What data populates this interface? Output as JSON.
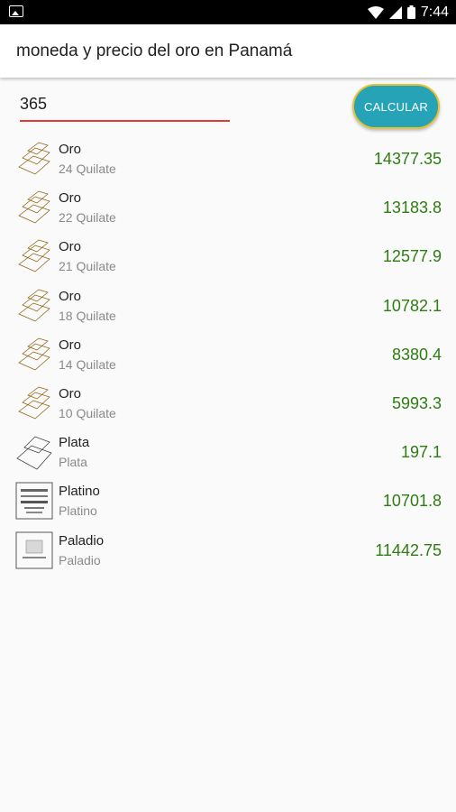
{
  "status_bar": {
    "time": "7:44"
  },
  "app": {
    "title": "moneda y precio del oro en Panamá"
  },
  "input": {
    "value": "365"
  },
  "calculate_button": {
    "label": "CALCULAR"
  },
  "colors": {
    "accent": "#26a3b6",
    "price": "#2e7d12",
    "underline": "#e53935"
  },
  "items": [
    {
      "name": "Oro",
      "subtitle": "24 Quilate",
      "price": "14377.35",
      "icon": "gold-bars-icon"
    },
    {
      "name": "Oro",
      "subtitle": "22 Quilate",
      "price": "13183.8",
      "icon": "gold-bars-icon"
    },
    {
      "name": "Oro",
      "subtitle": "21 Quilate",
      "price": "12577.9",
      "icon": "gold-bars-icon"
    },
    {
      "name": "Oro",
      "subtitle": "18 Quilate",
      "price": "10782.1",
      "icon": "gold-bars-icon"
    },
    {
      "name": "Oro",
      "subtitle": "14 Quilate",
      "price": "8380.4",
      "icon": "gold-bars-icon"
    },
    {
      "name": "Oro",
      "subtitle": "10 Quilate",
      "price": "5993.3",
      "icon": "gold-bars-icon"
    },
    {
      "name": "Plata",
      "subtitle": "Plata",
      "price": "197.1",
      "icon": "silver-bars-icon"
    },
    {
      "name": "Platino",
      "subtitle": "Platino",
      "price": "10701.8",
      "icon": "platinum-bar-icon"
    },
    {
      "name": "Paladio",
      "subtitle": "Paladio",
      "price": "11442.75",
      "icon": "palladium-bar-icon"
    }
  ]
}
